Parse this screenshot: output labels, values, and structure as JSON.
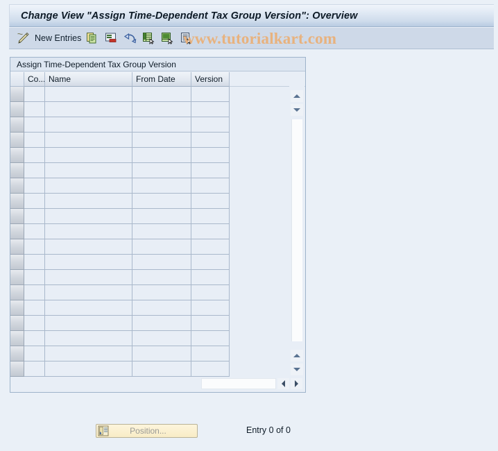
{
  "window": {
    "title": "Change View \"Assign Time-Dependent Tax Group Version\": Overview"
  },
  "toolbar": {
    "new_entries_label": "New Entries",
    "items": [
      {
        "name": "change-display-icon",
        "label": ""
      },
      {
        "name": "new-entries-button",
        "label": "New Entries"
      },
      {
        "name": "copy-as-icon",
        "label": ""
      },
      {
        "name": "delete-icon",
        "label": ""
      },
      {
        "name": "undo-change-icon",
        "label": ""
      },
      {
        "name": "select-all-icon",
        "label": ""
      },
      {
        "name": "deselect-all-icon",
        "label": ""
      },
      {
        "name": "details-icon",
        "label": ""
      }
    ]
  },
  "watermark": {
    "text": "www.tutorialkart.com",
    "color": "#e8b27e"
  },
  "table": {
    "caption": "Assign Time-Dependent Tax Group Version",
    "columns": [
      {
        "label": "Co...",
        "width": 30
      },
      {
        "label": "Name",
        "width": 126
      },
      {
        "label": "From Date",
        "width": 85
      },
      {
        "label": "Version",
        "width": 55
      }
    ],
    "rows": [],
    "row_count_rendered": 19,
    "config_icon": "table-settings-icon",
    "vertical_scrollbar": {
      "up_arrow": "scroll-up-icon",
      "down_arrow": "scroll-down-icon"
    },
    "horizontal_scrollbar": {
      "left_arrow": "scroll-left-icon",
      "right_arrow": "scroll-right-icon"
    }
  },
  "footer": {
    "position_button_label": "Position...",
    "position_button_icon": "position-icon",
    "entry_status": "Entry 0 of 0"
  },
  "colors": {
    "titlebar_top": "#f0f4fa",
    "titlebar_bottom": "#b8cce2",
    "toolbar_bg": "#ced9e8",
    "panel_bg": "#e8eef6",
    "panel_border": "#9db3ca",
    "grid_line": "#a9b8cb",
    "row_selector": "#d2d7de",
    "button_yellow": "#f8ecc6",
    "text": "#0d1a26"
  }
}
